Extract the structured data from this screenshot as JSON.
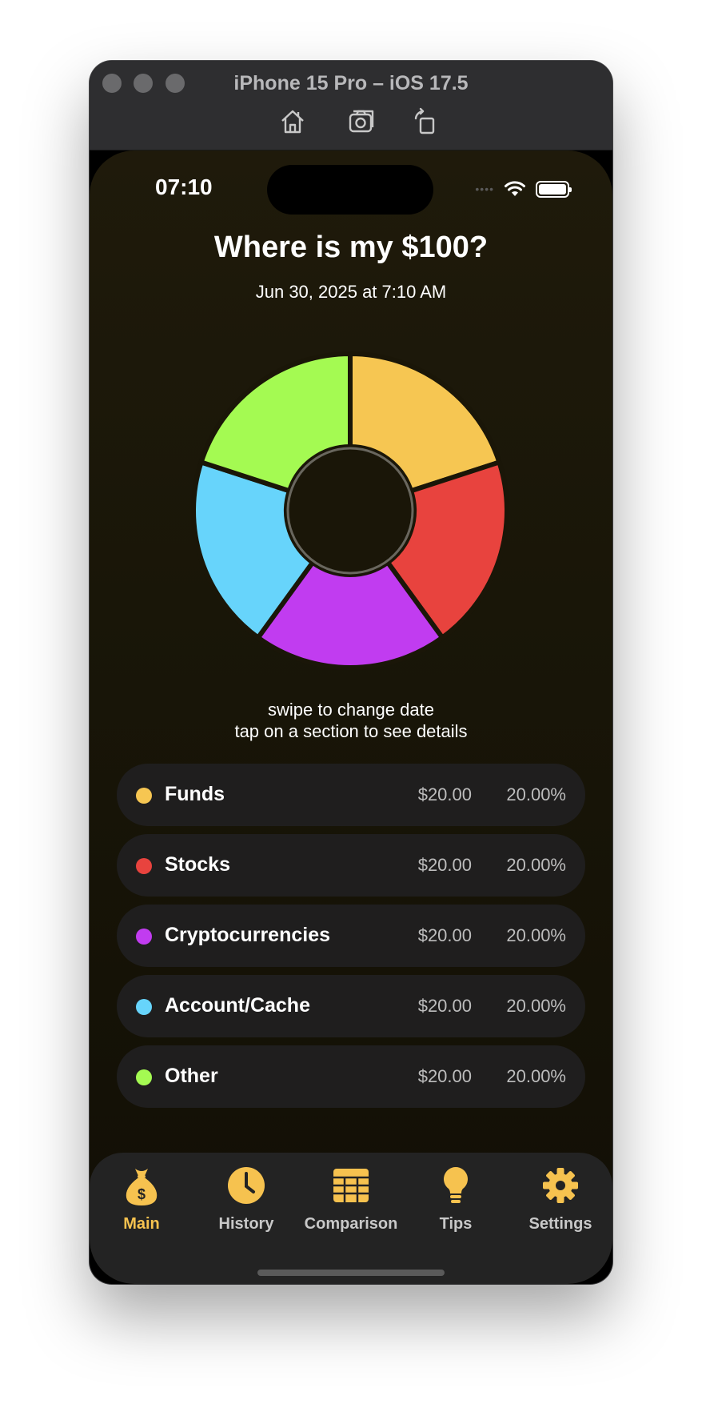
{
  "window": {
    "title": "iPhone 15 Pro – iOS 17.5",
    "toolbar": [
      "home-icon",
      "screenshot-icon",
      "rotate-icon"
    ]
  },
  "status_bar": {
    "time": "07:10",
    "signal": "••••",
    "icons": [
      "signal-dots-icon",
      "wifi-icon",
      "battery-icon"
    ]
  },
  "header": {
    "title": "Where is my $100?",
    "date": "Jun 30, 2025 at 7:10 AM"
  },
  "chart_data": {
    "type": "pie",
    "donut": true,
    "categories": [
      "Funds",
      "Stocks",
      "Cryptocurrencies",
      "Account/Cache",
      "Other"
    ],
    "values": [
      20,
      20,
      20,
      20,
      20
    ],
    "colors": [
      "#f6c652",
      "#e8433e",
      "#c13cf0",
      "#67d4fb",
      "#a4fa52"
    ]
  },
  "hints": {
    "line1": "swipe to change date",
    "line2": "tap on a section to see details"
  },
  "rows": [
    {
      "name": "Funds",
      "amount": "$20.00",
      "percent": "20.00%",
      "color": "#f6c652"
    },
    {
      "name": "Stocks",
      "amount": "$20.00",
      "percent": "20.00%",
      "color": "#e8433e"
    },
    {
      "name": "Cryptocurrencies",
      "amount": "$20.00",
      "percent": "20.00%",
      "color": "#c13cf0"
    },
    {
      "name": "Account/Cache",
      "amount": "$20.00",
      "percent": "20.00%",
      "color": "#67d4fb"
    },
    {
      "name": "Other",
      "amount": "$20.00",
      "percent": "20.00%",
      "color": "#a4fa52"
    }
  ],
  "tabs": [
    {
      "label": "Main",
      "icon": "money-bag-icon",
      "active": true
    },
    {
      "label": "History",
      "icon": "clock-icon",
      "active": false
    },
    {
      "label": "Comparison",
      "icon": "table-icon",
      "active": false
    },
    {
      "label": "Tips",
      "icon": "lightbulb-icon",
      "active": false
    },
    {
      "label": "Settings",
      "icon": "gear-icon",
      "active": false
    }
  ],
  "accent_color": "#f6c24f"
}
